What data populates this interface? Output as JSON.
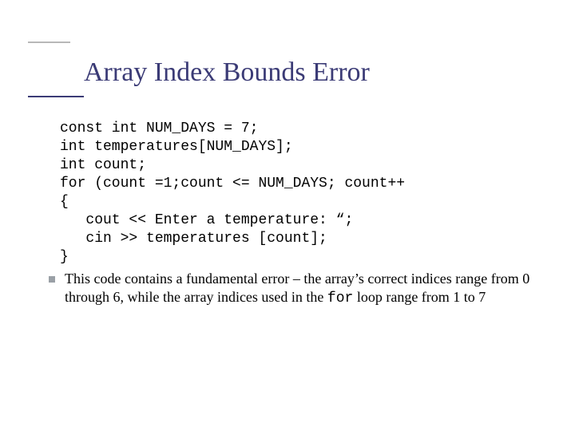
{
  "title": "Array Index Bounds Error",
  "code": {
    "l1": "const int NUM_DAYS = 7;",
    "l2": "int temperatures[NUM_DAYS];",
    "l3": "int count;",
    "l4": "for (count =1;count <= NUM_DAYS; count++",
    "l5": "{",
    "l6": "   cout << Enter a temperature: “;",
    "l7": "   cin >> temperatures [count];",
    "l8": "}"
  },
  "bullet": {
    "pre": "This code contains a fundamental error – the array’s correct indices range from  0 through 6, while the array indices used in the ",
    "mono": "for",
    "post": " loop range from 1 to 7"
  }
}
